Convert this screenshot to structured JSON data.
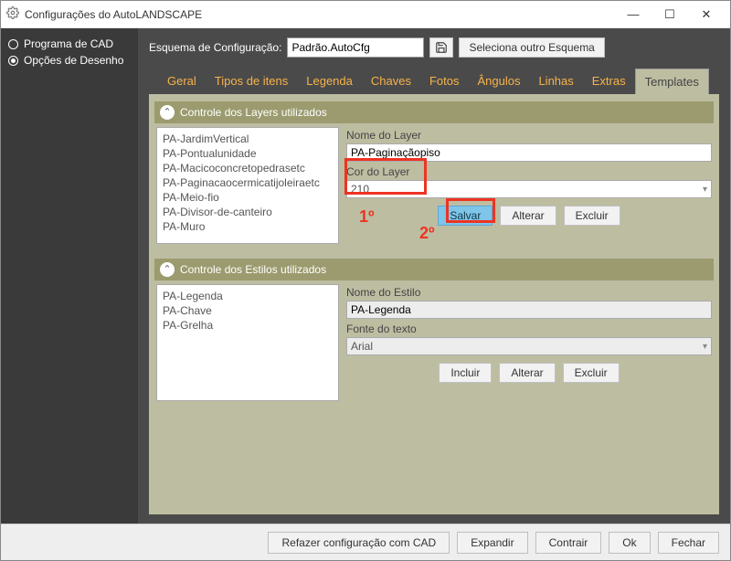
{
  "window": {
    "title": "Configurações do AutoLANDSCAPE"
  },
  "sidebar": {
    "items": [
      {
        "label": "Programa de CAD",
        "selected": false
      },
      {
        "label": "Opções de Desenho",
        "selected": true
      }
    ]
  },
  "config": {
    "label": "Esquema de Configuração:",
    "scheme_value": "Padrão.AutoCfg",
    "select_other": "Seleciona outro Esquema"
  },
  "tabs": [
    {
      "label": "Geral"
    },
    {
      "label": "Tipos de itens"
    },
    {
      "label": "Legenda"
    },
    {
      "label": "Chaves"
    },
    {
      "label": "Fotos"
    },
    {
      "label": "Ângulos"
    },
    {
      "label": "Linhas"
    },
    {
      "label": "Extras"
    },
    {
      "label": "Templates",
      "active": true
    }
  ],
  "layers": {
    "header": "Controle dos Layers utilizados",
    "items": [
      "PA-JardimVertical",
      "PA-Pontualunidade",
      "PA-Macicoconcretopedrasetc",
      "PA-Paginacaocermicatijoleiraetc",
      "PA-Meio-fio",
      "PA-Divisor-de-canteiro",
      "PA-Muro"
    ],
    "name_label": "Nome do Layer",
    "name_value": "PA-Paginaçãopiso",
    "color_label": "Cor do Layer",
    "color_value": "210",
    "buttons": {
      "save": "Salvar",
      "edit": "Alterar",
      "delete": "Excluir"
    }
  },
  "styles": {
    "header": "Controle dos Estilos utilizados",
    "items": [
      "PA-Legenda",
      "PA-Chave",
      "PA-Grelha"
    ],
    "name_label": "Nome do Estilo",
    "name_value": "PA-Legenda",
    "font_label": "Fonte do texto",
    "font_value": "Arial",
    "buttons": {
      "add": "Incluir",
      "edit": "Alterar",
      "delete": "Excluir"
    }
  },
  "annotations": {
    "first": "1º",
    "second": "2º"
  },
  "footer": {
    "remake": "Refazer configuração com CAD",
    "expand": "Expandir",
    "contract": "Contrair",
    "ok": "Ok",
    "close": "Fechar"
  }
}
